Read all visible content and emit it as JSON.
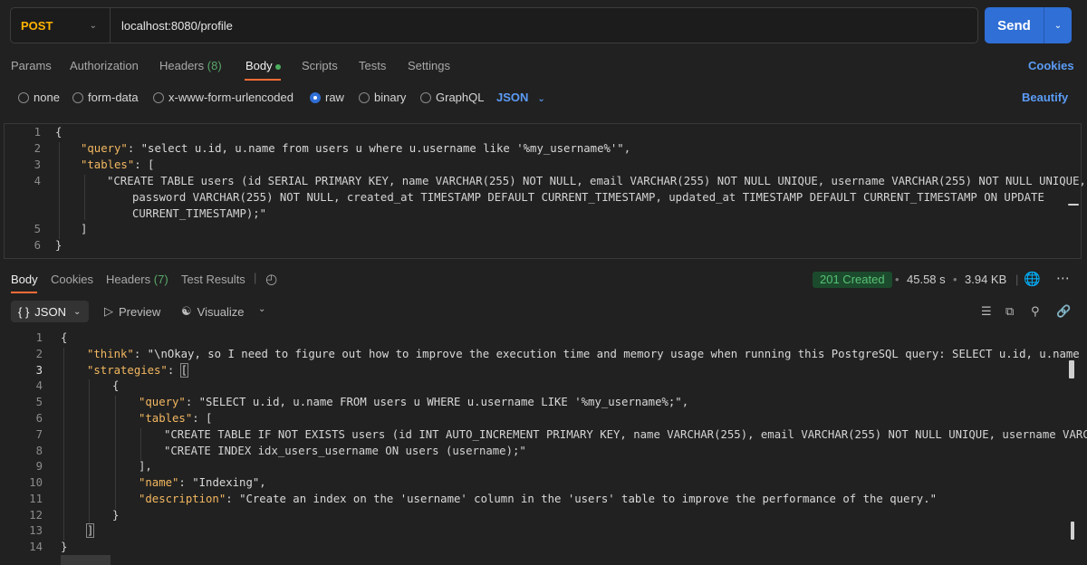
{
  "request": {
    "method": "POST",
    "url": "localhost:8080/profile",
    "send_label": "Send"
  },
  "request_tabs": {
    "params": "Params",
    "authorization": "Authorization",
    "headers": "Headers",
    "headers_count": "(8)",
    "body": "Body",
    "scripts": "Scripts",
    "tests": "Tests",
    "settings": "Settings",
    "cookies": "Cookies"
  },
  "body_types": {
    "none": "none",
    "form_data": "form-data",
    "urlencoded": "x-www-form-urlencoded",
    "raw": "raw",
    "binary": "binary",
    "graphql": "GraphQL",
    "language": "JSON",
    "beautify": "Beautify"
  },
  "request_body": {
    "line_numbers": [
      "1",
      "2",
      "3",
      "4",
      "5",
      "6"
    ],
    "l1": "{",
    "l2_key": "\"query\"",
    "l2_val": "\"select u.id, u.name from users u where u.username like '%my_username%'\"",
    "l3_key": "\"tables\"",
    "l4a": "\"CREATE TABLE users (id SERIAL PRIMARY KEY, name VARCHAR(255) NOT NULL, email VARCHAR(255) NOT NULL UNIQUE, username VARCHAR(255) NOT NULL UNIQUE,",
    "l4b": "password VARCHAR(255) NOT NULL, created_at TIMESTAMP DEFAULT CURRENT_TIMESTAMP, updated_at TIMESTAMP DEFAULT CURRENT_TIMESTAMP ON UPDATE",
    "l4c": "CURRENT_TIMESTAMP);\"",
    "l5": "]",
    "l6": "}"
  },
  "response_tabs": {
    "body": "Body",
    "cookies": "Cookies",
    "headers": "Headers",
    "headers_count": "(7)",
    "test_results": "Test Results"
  },
  "response_meta": {
    "status": "201 Created",
    "time": "45.58 s",
    "size": "3.94 KB"
  },
  "response_toolbar": {
    "format": "JSON",
    "preview": "Preview",
    "visualize": "Visualize"
  },
  "response_body": {
    "line_numbers": [
      "1",
      "2",
      "3",
      "4",
      "5",
      "6",
      "7",
      "8",
      "9",
      "10",
      "11",
      "12",
      "13",
      "14"
    ],
    "l1": "{",
    "l2_key": "\"think\"",
    "l2_val": "\"\\nOkay, so I need to figure out how to improve the execution time and memory usage when running this PostgreSQL query: SELECT u.id, u.name from",
    "l3_key": "\"strategies\"",
    "l4": "{",
    "l5_key": "\"query\"",
    "l5_val": "\"SELECT u.id, u.name FROM users u WHERE u.username LIKE '%my_username%;\"",
    "l6_key": "\"tables\"",
    "l7": "\"CREATE TABLE IF NOT EXISTS users (id INT AUTO_INCREMENT PRIMARY KEY, name VARCHAR(255), email VARCHAR(255) NOT NULL UNIQUE, username VARCHAR",
    "l8": "\"CREATE INDEX idx_users_username ON users (username);\"",
    "l9": "],",
    "l10_key": "\"name\"",
    "l10_val": "\"Indexing\"",
    "l11_key": "\"description\"",
    "l11_val": "\"Create an index on the 'username' column in the 'users' table to improve the performance of the query.\"",
    "l12": "}",
    "l13": "]",
    "l14": "}"
  }
}
